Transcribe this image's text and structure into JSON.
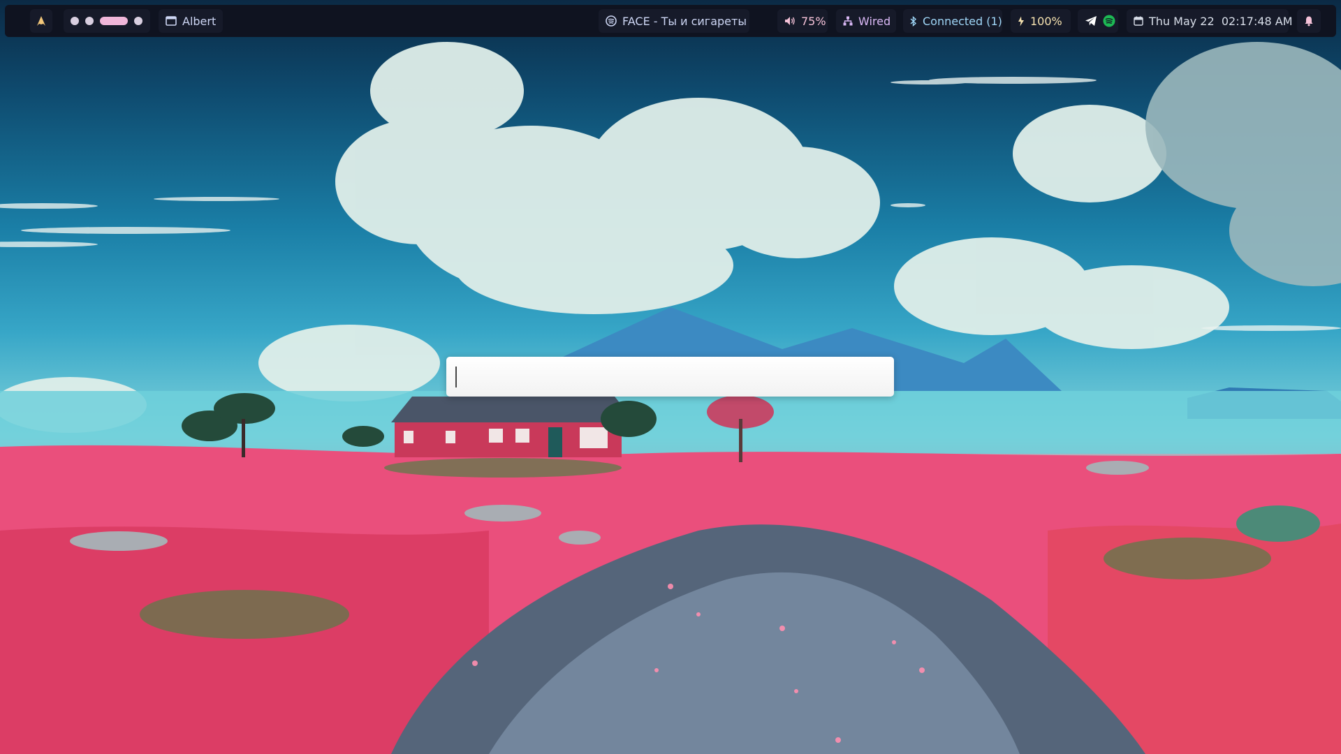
{
  "topbar": {
    "launcher_icon": "arch-logo-icon",
    "workspaces": [
      {
        "state": "inactive"
      },
      {
        "state": "inactive"
      },
      {
        "state": "active"
      },
      {
        "state": "inactive"
      }
    ],
    "window_title": "Albert",
    "media": "FACE - Ты и сигареты",
    "volume": "75%",
    "network": "Wired",
    "bluetooth": "Connected (1)",
    "battery": "100%",
    "clock": "Thu May 22  02:17:48 AM"
  },
  "launcher": {
    "query": ""
  },
  "colors": {
    "bar_bg": "#0f1320",
    "accent_pink": "#f0b6d9",
    "bar_text": "#cdd6f4",
    "spotify_green": "#1db954"
  }
}
